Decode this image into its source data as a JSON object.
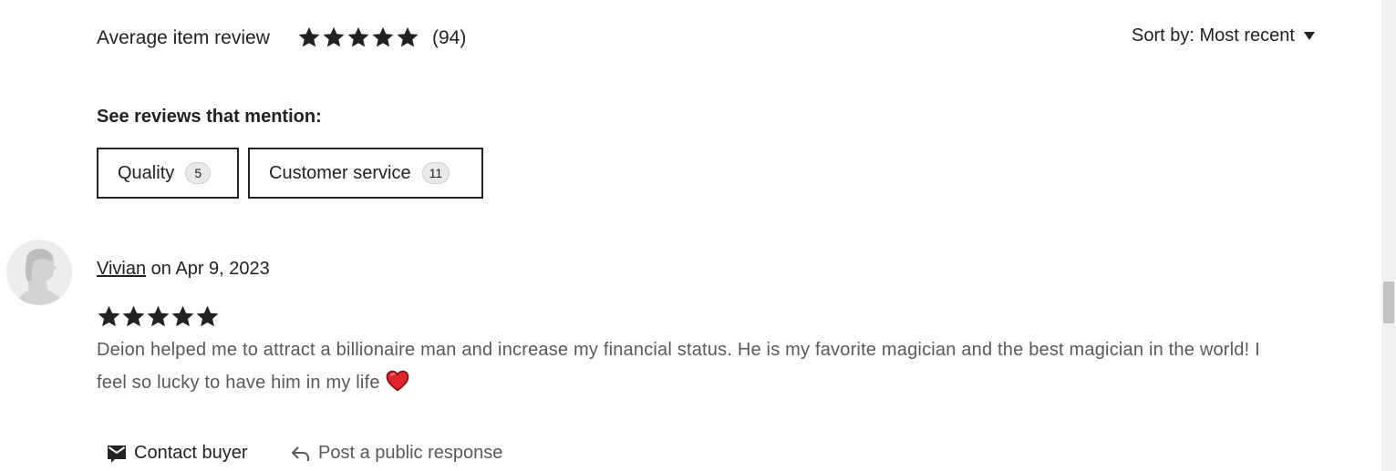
{
  "summary": {
    "average_label": "Average item review",
    "rating": 5,
    "max_rating": 5,
    "count": "(94)"
  },
  "sort": {
    "label": "Sort by: Most recent"
  },
  "mentions": {
    "title": "See reviews that mention:",
    "tags": [
      {
        "label": "Quality",
        "count": "5"
      },
      {
        "label": "Customer service",
        "count": "11"
      }
    ]
  },
  "review": {
    "user": "Vivian",
    "date_text": " on Apr 9, 2023",
    "rating": 5,
    "text": "Deion helped me to attract a billionaire man and increase my financial status. He is my favorite magician and the best magician in the world! I feel so lucky to have him in my life",
    "emoji": "red-heart-icon"
  },
  "actions": {
    "contact": "Contact buyer",
    "respond": "Post a public response"
  },
  "colors": {
    "text": "#222222",
    "muted": "#595959",
    "heart": "#e0242c",
    "badge_bg": "#e9e9e9"
  }
}
